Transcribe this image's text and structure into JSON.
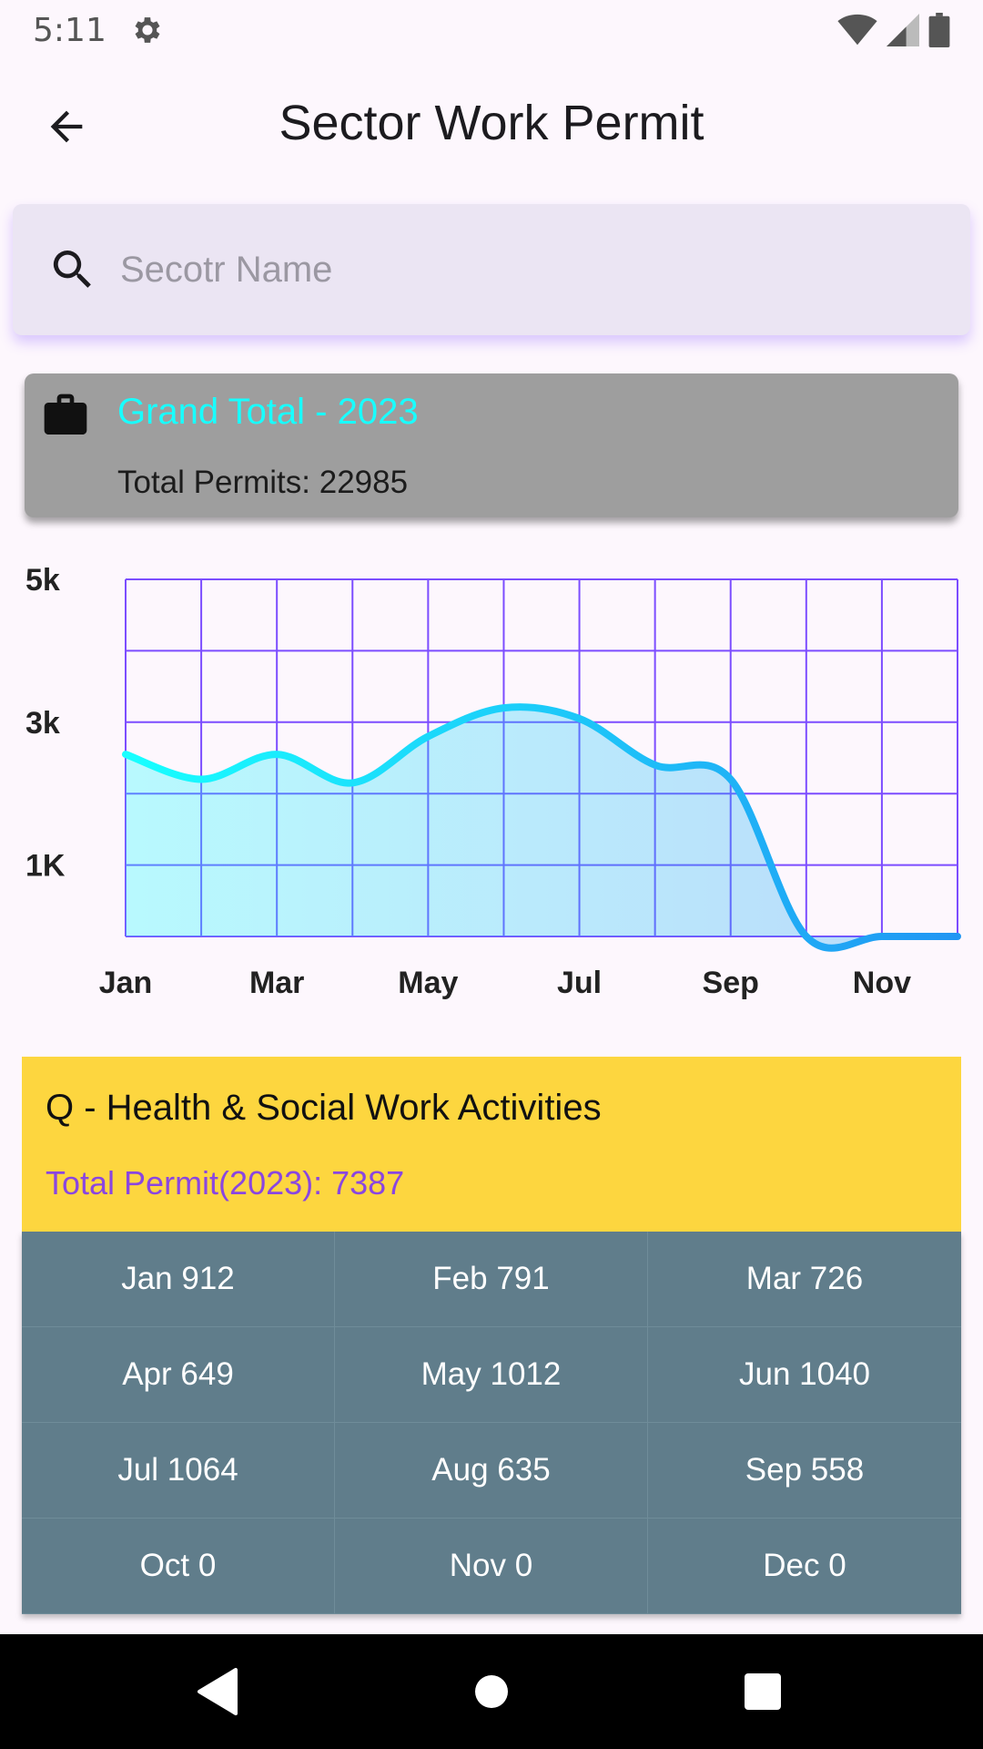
{
  "status_bar": {
    "time": "5:11"
  },
  "app_bar": {
    "title": "Sector Work Permit"
  },
  "search": {
    "placeholder": "Secotr Name",
    "value": ""
  },
  "total_card": {
    "title": "Grand Total - 2023",
    "subtitle": "Total Permits: 22985"
  },
  "chart_data": {
    "type": "area",
    "categories": [
      "Jan",
      "Feb",
      "Mar",
      "Apr",
      "May",
      "Jun",
      "Jul",
      "Aug",
      "Sep",
      "Oct",
      "Nov",
      "Dec"
    ],
    "x_tick_labels": [
      "Jan",
      "Mar",
      "May",
      "Jul",
      "Sep",
      "Nov"
    ],
    "y_tick_labels": [
      "5k",
      "3k",
      "1K"
    ],
    "values": [
      2550,
      2200,
      2550,
      2150,
      2800,
      3200,
      3050,
      2400,
      2200,
      0,
      0,
      0
    ],
    "ylim": [
      0,
      5000
    ],
    "grid": true,
    "colors": {
      "grid": "#7c4dff",
      "line_start": "#18ffff",
      "line_end": "#2196f3"
    }
  },
  "sector": {
    "name": "Q - Health & Social Work Activities",
    "total": "Total Permit(2023): 7387",
    "months": [
      "Jan 912",
      "Feb 791",
      "Mar 726",
      "Apr 649",
      "May 1012",
      "Jun 1040",
      "Jul 1064",
      "Aug 635",
      "Sep 558",
      "Oct 0",
      "Nov 0",
      "Dec 0"
    ]
  }
}
